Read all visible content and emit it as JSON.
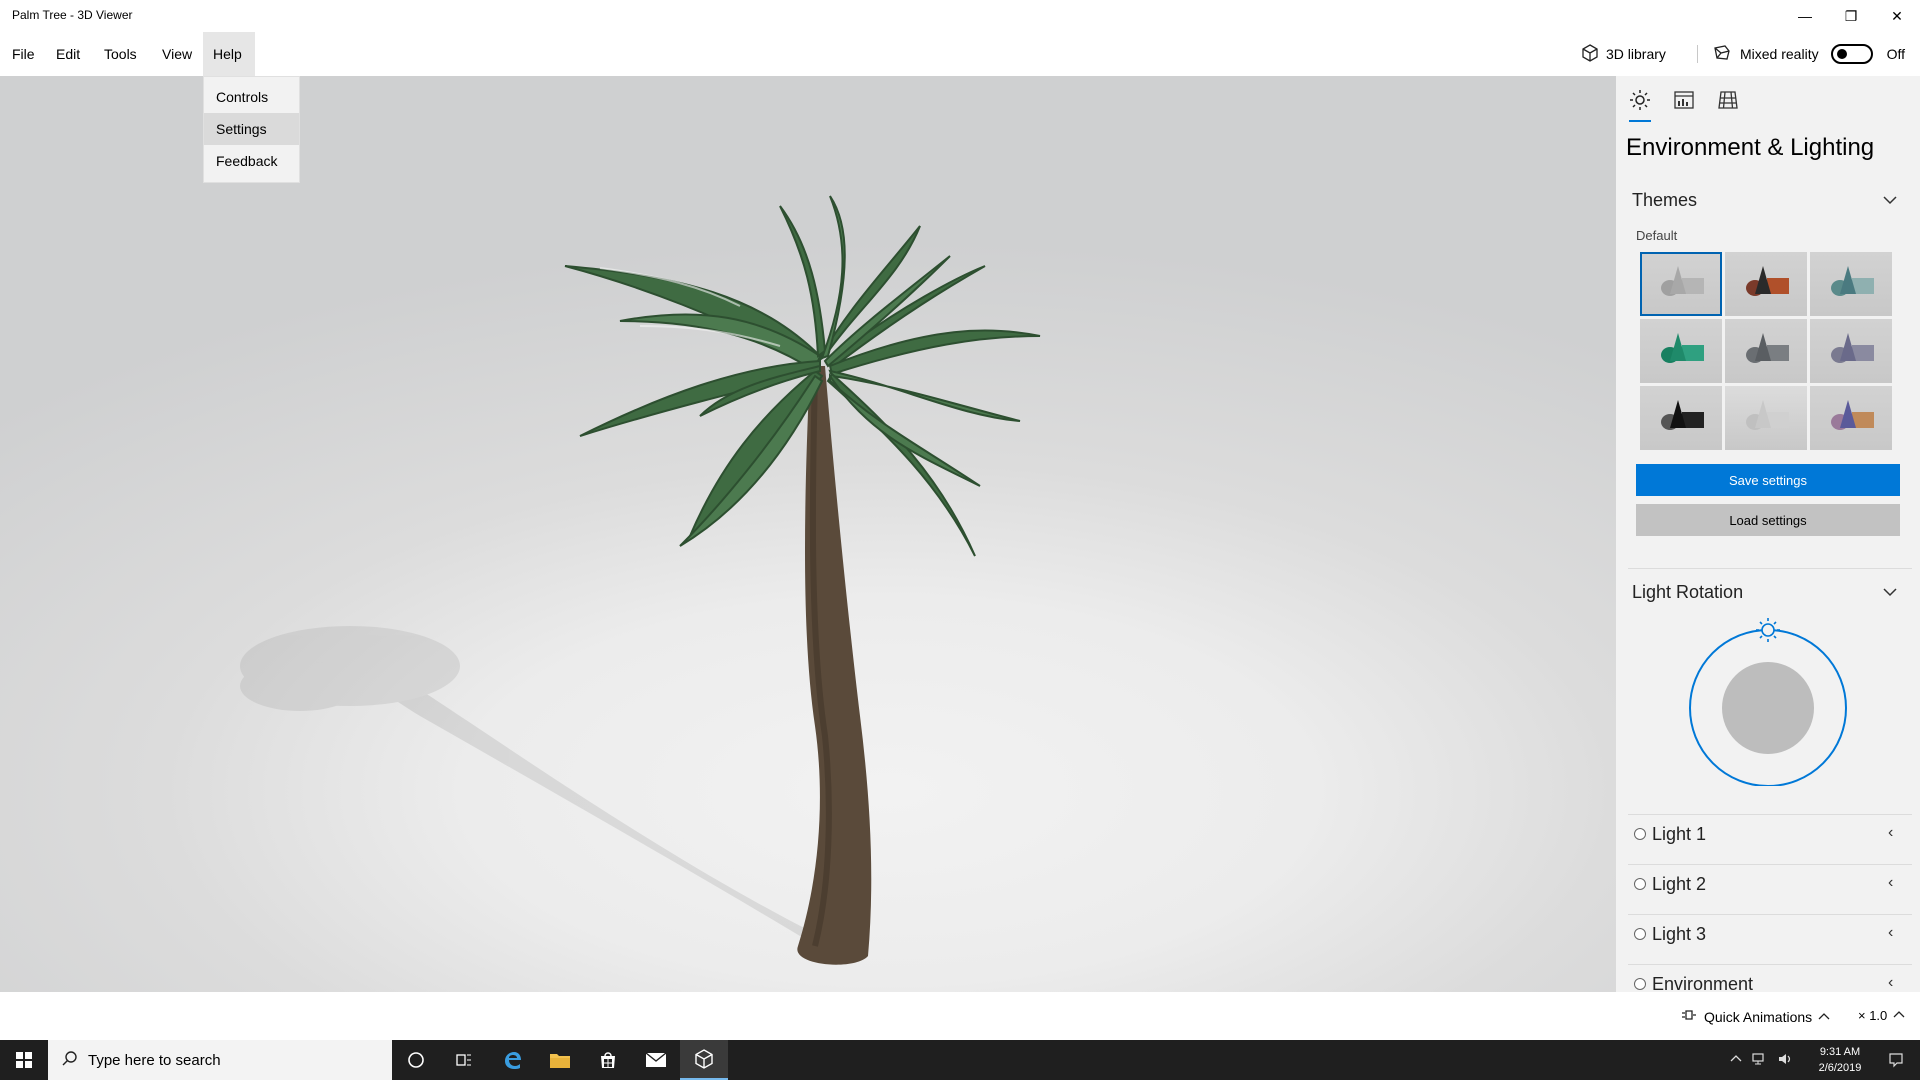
{
  "window": {
    "title": "Palm Tree - 3D Viewer",
    "controls": [
      "—",
      "❐",
      "✕"
    ]
  },
  "menubar": {
    "items": [
      "File",
      "Edit",
      "Tools",
      "View",
      "Help"
    ],
    "active": "Help",
    "library_label": "3D library",
    "mixed_reality_label": "Mixed reality",
    "mixed_reality_state": "Off"
  },
  "help_menu": {
    "items": [
      "Controls",
      "Settings",
      "Feedback"
    ],
    "hovered": "Settings"
  },
  "panel": {
    "tabs": [
      "sun-icon",
      "stats-icon",
      "grid-icon"
    ],
    "active_tab": "sun-icon",
    "title": "Environment & Lighting",
    "themes": {
      "heading": "Themes",
      "default_label": "Default",
      "selected_index": 0,
      "swatches": [
        {
          "bg": "#d2d2d2",
          "cone": "#a8a8a8",
          "box": "#b5b5b5",
          "ball": "#a0a0a0"
        },
        {
          "bg": "#d2d2d2",
          "cone": "#2a2a2a",
          "box": "#b0502a",
          "ball": "#7a3a2a"
        },
        {
          "bg": "#d2d2d2",
          "cone": "#4a7a80",
          "box": "#8fb0b0",
          "ball": "#5a8a8a"
        },
        {
          "bg": "#d2d2d2",
          "cone": "#1f8a6a",
          "box": "#2fa080",
          "ball": "#188060"
        },
        {
          "bg": "#d2d2d2",
          "cone": "#5a5e62",
          "box": "#7a7e82",
          "ball": "#6a6e72"
        },
        {
          "bg": "#d2d2d2",
          "cone": "#6a6a8a",
          "box": "#8a8aa0",
          "ball": "#7a7a90"
        },
        {
          "bg": "#d2d2d2",
          "cone": "#111111",
          "box": "#222222",
          "ball": "#555555"
        },
        {
          "bg": "#dcdcdc",
          "cone": "#c8c8c8",
          "box": "#d0d0d0",
          "ball": "#c0c0c0"
        },
        {
          "bg": "#d2d2d2",
          "cone": "#5a5a9a",
          "box": "#c08a5a",
          "ball": "#9a7a9a"
        }
      ],
      "save_label": "Save settings",
      "load_label": "Load settings"
    },
    "light_rotation": {
      "heading": "Light Rotation"
    },
    "lights": [
      "Light 1",
      "Light 2",
      "Light 3",
      "Environment"
    ]
  },
  "statusbar": {
    "animations_label": "Quick Animations",
    "speed": "× 1.0"
  },
  "taskbar": {
    "search_placeholder": "Type here to search",
    "time": "9:31 AM",
    "date": "2/6/2019"
  },
  "colors": {
    "accent": "#0078d7",
    "panel_bg": "#f2f2f2",
    "taskbar_bg": "#1f1f1f",
    "foliage": "#3f6b42",
    "trunk": "#5a4a3a"
  }
}
